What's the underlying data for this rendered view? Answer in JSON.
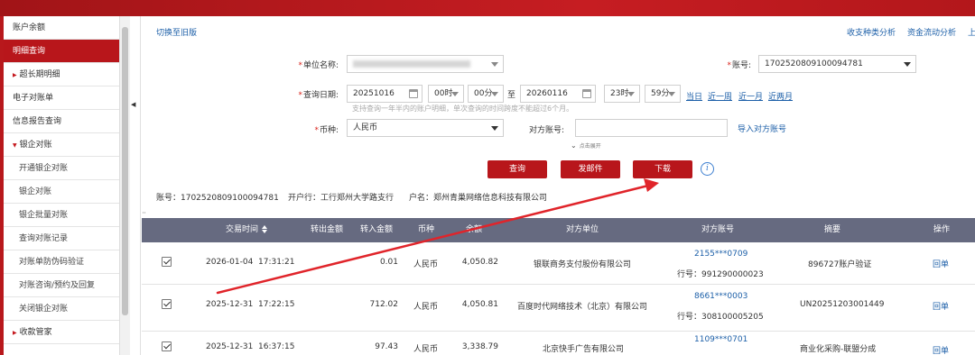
{
  "sidebar": {
    "items": [
      {
        "label": "账户余额"
      },
      {
        "label": "明细查询"
      },
      {
        "label": "超长期明细"
      },
      {
        "label": "电子对账单"
      },
      {
        "label": "信息报告查询"
      },
      {
        "label": "银企对账"
      },
      {
        "label": "开通银企对账"
      },
      {
        "label": "银企对账"
      },
      {
        "label": "银企批量对账"
      },
      {
        "label": "查询对账记录"
      },
      {
        "label": "对账单防伪码验证"
      },
      {
        "label": "对账咨询/预约及回复"
      },
      {
        "label": "关闭银企对账"
      },
      {
        "label": "收款管家"
      }
    ]
  },
  "top_links": {
    "switch_old": "切换至旧版",
    "income_analysis": "收支种类分析",
    "fund_flow": "资金流动分析",
    "more": "上"
  },
  "form": {
    "unit_label": "单位名称:",
    "account_label": "账号:",
    "account_value": "1702520809100094781",
    "date_label": "查询日期:",
    "start_date": "20251016",
    "start_hour": "00时",
    "start_min": "00分",
    "to": "至",
    "end_date": "20260116",
    "end_hour": "23时",
    "end_min": "59分",
    "quick": [
      "当日",
      "近一周",
      "近一月",
      "近两月"
    ],
    "hint": "支持查询一年半内的账户明细，单次查询的时间跨度不能超过6个月。",
    "currency_label": "币种:",
    "currency_value": "人民币",
    "counter_label": "对方账号:",
    "import_link": "导入对方账号",
    "expand": "点击展开"
  },
  "buttons": {
    "query": "查询",
    "email": "发邮件",
    "download": "下载"
  },
  "account_info": {
    "account": "账号：1702520809100094781",
    "bank": "开户行：工行郑州大学路支行",
    "holder": "户名：郑州青巢网络信息科技有限公司"
  },
  "table": {
    "headers": [
      "交易时间",
      "转出金额",
      "转入金额",
      "币种",
      "余额",
      "对方单位",
      "对方账号",
      "摘要",
      "操作"
    ],
    "rows": [
      {
        "date": "2026-01-04",
        "time": "17:31:21",
        "out": "",
        "in": "0.01",
        "currency": "人民币",
        "balance": "4,050.82",
        "counterparty": "银联商务支付股份有限公司",
        "acct": "2155***0709",
        "bank_no": "行号：991290000023",
        "memo": "896727账户验证",
        "op": "回单"
      },
      {
        "date": "2025-12-31",
        "time": "17:22:15",
        "out": "",
        "in": "712.02",
        "currency": "人民币",
        "balance": "4,050.81",
        "counterparty": "百度时代网络技术（北京）有限公司",
        "acct": "8661***0003",
        "bank_no": "行号：308100005205",
        "memo": "UN20251203001449",
        "op": "回单"
      },
      {
        "date": "2025-12-31",
        "time": "16:37:15",
        "out": "",
        "in": "97.43",
        "currency": "人民币",
        "balance": "3,338.79",
        "counterparty": "北京快手广告有限公司",
        "acct": "1109***0701",
        "bank_no": "",
        "memo": "商业化采购-联盟分成",
        "op": "回单"
      }
    ]
  }
}
